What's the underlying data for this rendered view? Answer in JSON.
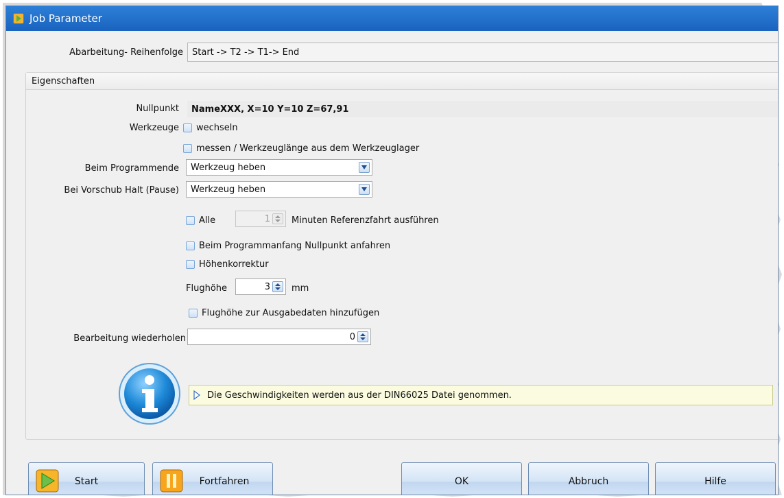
{
  "window": {
    "title": "Job Parameter"
  },
  "sequence": {
    "label": "Abarbeitung- Reihenfolge",
    "value": "Start  -> T2 -> T1-> End"
  },
  "properties": {
    "header": "Eigenschaften",
    "nullpunkt": {
      "label": "Nullpunkt",
      "value": "NameXXX, X=10  Y=10  Z=67,91"
    },
    "werkzeuge": {
      "label": "Werkzeuge",
      "wechseln": "wechseln",
      "messen": "messen / Werkzeuglänge aus dem Werkzeuglager"
    },
    "programmende": {
      "label": "Beim Programmende",
      "value": "Werkzeug heben"
    },
    "vorschub_halt": {
      "label": "Bei Vorschub Halt (Pause)",
      "value": "Werkzeug heben"
    },
    "referenz": {
      "alle": "Alle",
      "minutes": "1",
      "suffix": "Minuten Referenzfahrt ausführen"
    },
    "nullpunkt_anfahren": "Beim Programmanfang Nullpunkt anfahren",
    "hoehenkorrektur": "Höhenkorrektur",
    "flughoehe": {
      "label": "Flughöhe",
      "value": "3",
      "unit": "mm"
    },
    "flughoehe_ausgabe": "Flughöhe zur Ausgabedaten hinzufügen",
    "wiederholen": {
      "label": "Bearbeitung wiederholen",
      "value": "0"
    }
  },
  "info": {
    "message": "Die Geschwindigkeiten werden aus der DIN66025 Datei genommen."
  },
  "buttons": {
    "start": "Start",
    "fortfahren": "Fortfahren",
    "ok": "OK",
    "abbruch": "Abbruch",
    "hilfe": "Hilfe"
  },
  "colors": {
    "titlebar": "#1a63bf",
    "info_background": "#fbfbe0",
    "button_border": "#6e8db4"
  }
}
